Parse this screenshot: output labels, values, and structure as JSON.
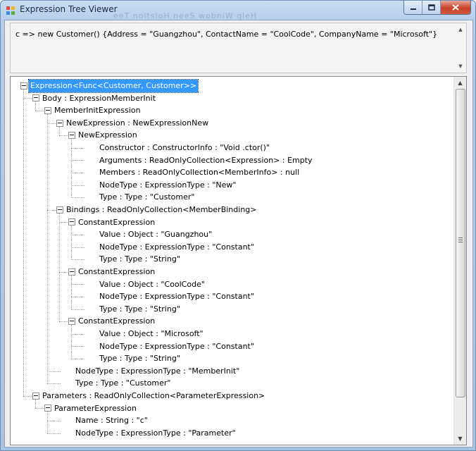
{
  "window": {
    "title": "Expression Tree Viewer",
    "background_hint": "eeT noitsloH   neeS   wobniW   qleH"
  },
  "expression": {
    "text": "c => new Customer() {Address = \"Guangzhou\", ContactName = \"CoolCode\", CompanyName = \"Microsoft\"}"
  },
  "tree": {
    "nodes": [
      {
        "label": "Expression<Func<Customer, Customer>>",
        "level": 0,
        "expanded": true,
        "selected": true
      },
      {
        "label": "Body : ExpressionMemberInit",
        "level": 1,
        "expanded": true
      },
      {
        "label": "MemberInitExpression",
        "level": 2,
        "expanded": true
      },
      {
        "label": "NewExpression : NewExpressionNew",
        "level": 3,
        "expanded": true
      },
      {
        "label": "NewExpression",
        "level": 4,
        "expanded": true
      },
      {
        "label": "Constructor : ConstructorInfo : \"Void .ctor()\"",
        "level": 5
      },
      {
        "label": "Arguments : ReadOnlyCollection<Expression> : Empty",
        "level": 5
      },
      {
        "label": "Members : ReadOnlyCollection<MemberInfo> : null",
        "level": 5
      },
      {
        "label": "NodeType : ExpressionType : \"New\"",
        "level": 5
      },
      {
        "label": "Type : Type : \"Customer\"",
        "level": 5
      },
      {
        "label": "Bindings : ReadOnlyCollection<MemberBinding>",
        "level": 3,
        "expanded": true
      },
      {
        "label": "ConstantExpression",
        "level": 4,
        "expanded": true
      },
      {
        "label": "Value : Object : \"Guangzhou\"",
        "level": 5
      },
      {
        "label": "NodeType : ExpressionType : \"Constant\"",
        "level": 5
      },
      {
        "label": "Type : Type : \"String\"",
        "level": 5
      },
      {
        "label": "ConstantExpression",
        "level": 4,
        "expanded": true
      },
      {
        "label": "Value : Object : \"CoolCode\"",
        "level": 5
      },
      {
        "label": "NodeType : ExpressionType : \"Constant\"",
        "level": 5
      },
      {
        "label": "Type : Type : \"String\"",
        "level": 5
      },
      {
        "label": "ConstantExpression",
        "level": 4,
        "expanded": true
      },
      {
        "label": "Value : Object : \"Microsoft\"",
        "level": 5
      },
      {
        "label": "NodeType : ExpressionType : \"Constant\"",
        "level": 5
      },
      {
        "label": "Type : Type : \"String\"",
        "level": 5
      },
      {
        "label": "NodeType : ExpressionType : \"MemberInit\"",
        "level": 3
      },
      {
        "label": "Type : Type : \"Customer\"",
        "level": 3
      },
      {
        "label": "Parameters : ReadOnlyCollection<ParameterExpression>",
        "level": 1,
        "expanded": true
      },
      {
        "label": "ParameterExpression",
        "level": 2,
        "expanded": true
      },
      {
        "label": "Name : String : \"c\"",
        "level": 3
      },
      {
        "label": "NodeType : ExpressionType : \"Parameter\"",
        "level": 3
      }
    ]
  },
  "icons": {
    "app": "app-icon",
    "minimize": "minimize-icon",
    "maximize": "maximize-icon",
    "close": "close-icon",
    "scroll_up": "scroll-up-arrow-icon",
    "scroll_down": "scroll-down-arrow-icon"
  },
  "colors": {
    "selection": "#3399ff",
    "close_button": "#c7412a"
  }
}
